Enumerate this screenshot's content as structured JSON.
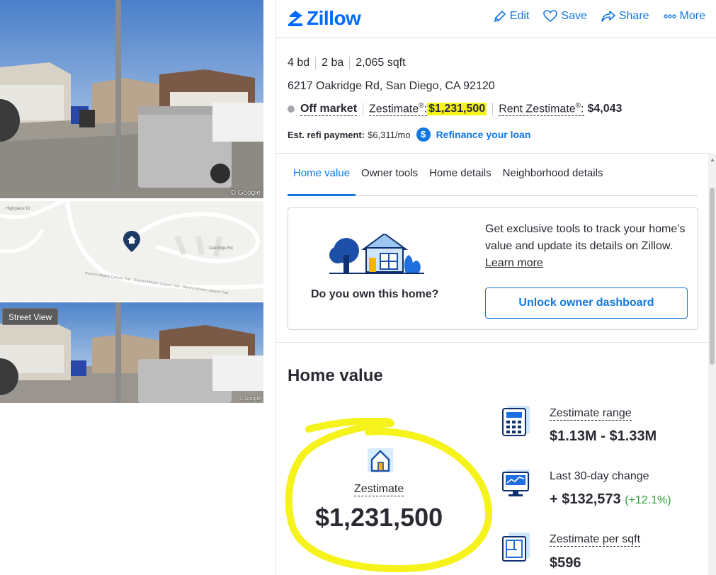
{
  "media": {
    "photo_credit": "© Google",
    "street_view_label": "Street View",
    "map_labels": [
      "Highplace Dr",
      "Oakridge Rd",
      "Rancho Mission Canyon Trail - Rancho Mission Canyon Trail - Rancho Mission Canyon Trail"
    ]
  },
  "header": {
    "logo_text": "Zillow",
    "actions": [
      {
        "label": "Edit",
        "icon": "pencil-icon"
      },
      {
        "label": "Save",
        "icon": "heart-icon"
      },
      {
        "label": "Share",
        "icon": "share-icon"
      },
      {
        "label": "More",
        "icon": "more-icon"
      }
    ]
  },
  "property": {
    "beds": "4 bd",
    "baths": "2 ba",
    "sqft": "2,065 sqft",
    "address": "6217 Oakridge Rd, San Diego, CA 92120",
    "status": "Off market",
    "zestimate_label": "Zestimate",
    "zestimate_value": "$1,231,500",
    "rent_label": "Rent Zestimate",
    "rent_value": "$4,043",
    "refi_label": "Est. refi payment:",
    "refi_value": "$6,311/mo",
    "refi_link": "Refinance your loan"
  },
  "tabs": [
    "Home value",
    "Owner tools",
    "Home details",
    "Neighborhood details"
  ],
  "owner_card": {
    "question": "Do you own this home?",
    "text": "Get exclusive tools to track your home’s value and update its details on Zillow.",
    "learn_more": "Learn more",
    "button": "Unlock owner dashboard"
  },
  "home_value": {
    "title": "Home value",
    "zestimate_label": "Zestimate",
    "zestimate_value": "$1,231,500",
    "range_label": "Zestimate range",
    "range_value": "$1.13M - $1.33M",
    "change_label": "Last 30-day change",
    "change_value": "+ $132,573",
    "change_pct": "(+12.1%)",
    "persqft_label": "Zestimate per sqft",
    "persqft_value": "$596"
  },
  "colors": {
    "brand": "#006aff",
    "link": "#1277e1",
    "highlight": "#f5f21c",
    "annotation": "#f5f21c",
    "positive": "#2d9e3a"
  }
}
